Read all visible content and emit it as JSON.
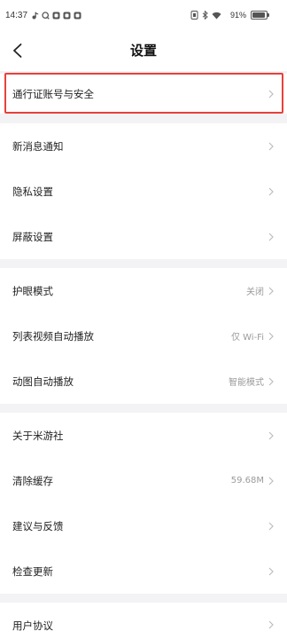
{
  "status_bar": {
    "time": "14:37",
    "battery_percent": "91%",
    "left_icons": [
      "tiktok-icon",
      "q-icon",
      "app-icon",
      "app-icon",
      "app-icon"
    ],
    "right_icons": [
      "nfc-icon",
      "bluetooth-icon",
      "wifi-icon",
      "battery-icon"
    ]
  },
  "header": {
    "back_icon": "back-arrow-icon",
    "title": "设置"
  },
  "chevron_icon": "chevron-right-icon",
  "colors": {
    "highlight": "#e8403a",
    "page_bg": "#f3f3f5",
    "value_text": "#9b9b9b",
    "label_text": "#222222",
    "chevron": "#bdbdbd"
  },
  "sections": [
    {
      "items": [
        {
          "label": "通行证账号与安全",
          "highlighted": true
        }
      ]
    },
    {
      "items": [
        {
          "label": "新消息通知"
        },
        {
          "label": "隐私设置"
        },
        {
          "label": "屏蔽设置"
        }
      ]
    },
    {
      "items": [
        {
          "label": "护眼模式",
          "value": "关闭"
        },
        {
          "label": "列表视频自动播放",
          "value": "仅 Wi-Fi"
        },
        {
          "label": "动图自动播放",
          "value": "智能模式"
        }
      ]
    },
    {
      "items": [
        {
          "label": "关于米游社"
        },
        {
          "label": "清除缓存",
          "value": "59.68M"
        },
        {
          "label": "建议与反馈"
        },
        {
          "label": "检查更新"
        }
      ]
    },
    {
      "items": [
        {
          "label": "用户协议"
        }
      ]
    }
  ]
}
